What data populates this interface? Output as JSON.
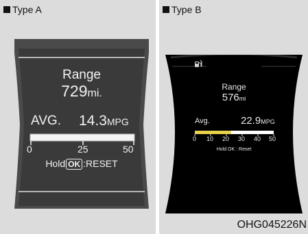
{
  "type_a": {
    "label": "Type A",
    "range_label": "Range",
    "range_value": "729",
    "range_unit": "mi.",
    "avg_label": "AVG.",
    "avg_value": "14.3",
    "avg_unit": "MPG",
    "gauge_ticks": [
      "0",
      "25",
      "50"
    ],
    "reset_hold": "Hold",
    "reset_ok": "OK",
    "reset_text": ":RESET"
  },
  "type_b": {
    "label": "Type B",
    "range_label": "Range",
    "range_value": "576",
    "range_unit": "mi",
    "avg_label": "Avg.",
    "avg_value": "22.9",
    "avg_unit": "MPG",
    "gauge_ticks": [
      "0",
      "10",
      "20",
      "30",
      "40",
      "50"
    ],
    "gauge_fill_value": 22.9,
    "reset_hold": "Hold",
    "reset_ok": "OK",
    "reset_text": ": Reset",
    "top_icon": "fuel-pump-icon"
  },
  "figure_code": "OHG045226N",
  "colors": {
    "background": "#dcdcdc",
    "display_a": "#3a3a3a",
    "display_b": "#000000",
    "gauge_b_fill": "#e8d24a"
  }
}
